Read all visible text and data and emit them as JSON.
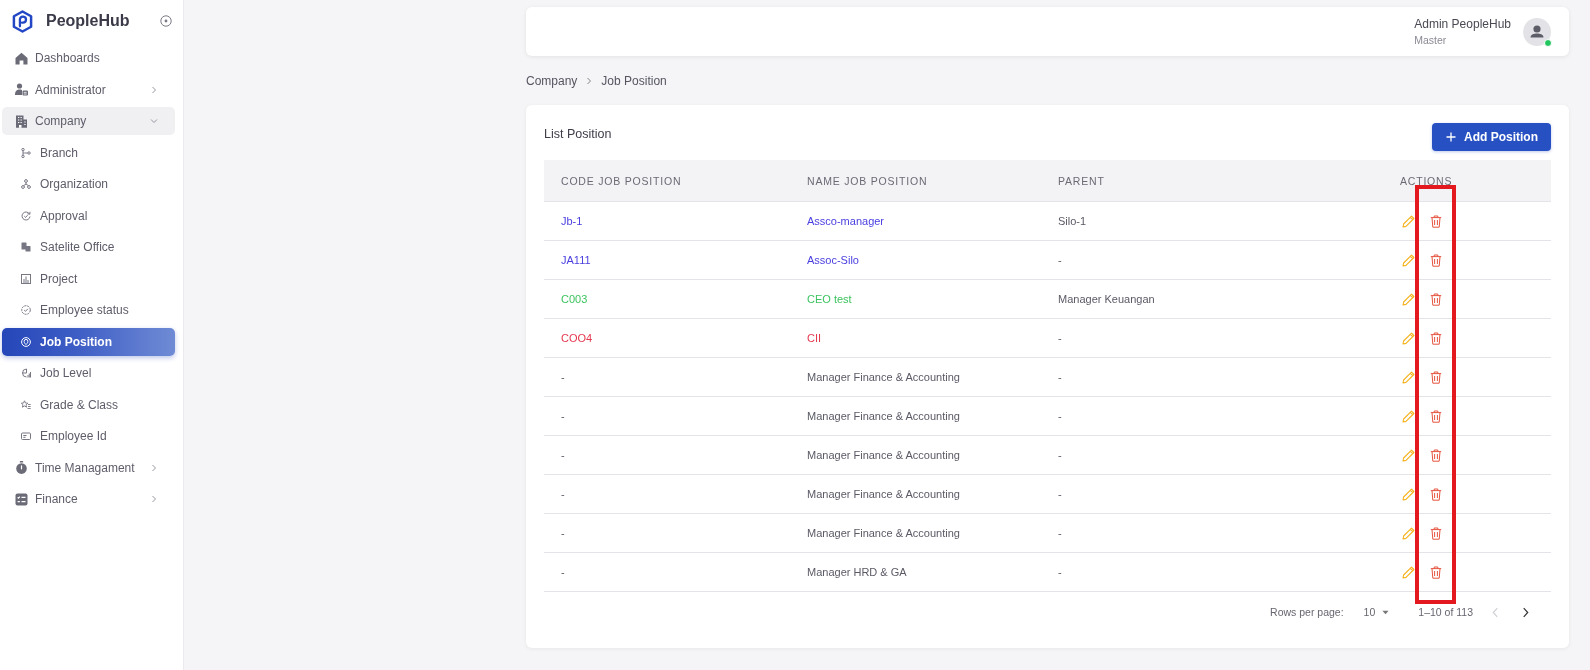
{
  "sidebar": {
    "app_name": "PeopleHub",
    "items": [
      {
        "label": "Dashboards",
        "kind": "link",
        "selected": false
      },
      {
        "label": "Administrator",
        "kind": "group",
        "selected": false,
        "expanded": false
      },
      {
        "label": "Company",
        "kind": "group",
        "selected": false,
        "expanded": true,
        "children": [
          {
            "label": "Branch",
            "selected": false
          },
          {
            "label": "Organization",
            "selected": false
          },
          {
            "label": "Approval",
            "selected": false
          },
          {
            "label": "Satelite Office",
            "selected": false
          },
          {
            "label": "Project",
            "selected": false
          },
          {
            "label": "Employee status",
            "selected": false
          },
          {
            "label": "Job Position",
            "selected": true
          },
          {
            "label": "Job Level",
            "selected": false
          },
          {
            "label": "Grade & Class",
            "selected": false
          },
          {
            "label": "Employee Id",
            "selected": false
          }
        ]
      },
      {
        "label": "Time Managament",
        "kind": "group",
        "selected": false,
        "expanded": false
      },
      {
        "label": "Finance",
        "kind": "group",
        "selected": false,
        "expanded": false
      }
    ]
  },
  "header": {
    "user": {
      "name": "Admin PeopleHub",
      "role": "Master",
      "online": true
    }
  },
  "breadcrumb": [
    "Company",
    "Job Position"
  ],
  "card": {
    "title": "List Position",
    "add_button": "Add Position",
    "table": {
      "columns": [
        "CODE JOB POSITION",
        "NAME JOB POSITION",
        "PARENT",
        "ACTIONS"
      ],
      "rows": [
        {
          "code": "Jb-1",
          "name": "Assco-manager",
          "parent": "Silo-1",
          "color": "#4a3fe0"
        },
        {
          "code": "JA111",
          "name": "Assoc-Silo",
          "parent": "-",
          "color": "#4a3fe0"
        },
        {
          "code": "C003",
          "name": "CEO test",
          "parent": "Manager Keuangan",
          "color": "#3cc35f"
        },
        {
          "code": "COO4",
          "name": "CII",
          "parent": "-",
          "color": "#e5384f"
        },
        {
          "code": "-",
          "name": "Manager Finance & Accounting",
          "parent": "-"
        },
        {
          "code": "-",
          "name": "Manager Finance & Accounting",
          "parent": "-"
        },
        {
          "code": "-",
          "name": "Manager Finance & Accounting",
          "parent": "-"
        },
        {
          "code": "-",
          "name": "Manager Finance & Accounting",
          "parent": "-"
        },
        {
          "code": "-",
          "name": "Manager Finance & Accounting",
          "parent": "-"
        },
        {
          "code": "-",
          "name": "Manager HRD & GA",
          "parent": "-"
        }
      ]
    },
    "pagination": {
      "rows_per_page_label": "Rows per page:",
      "rows_per_page": "10",
      "range": "1–10 of 113",
      "prev_disabled": true,
      "next_disabled": false
    }
  },
  "highlight_box": true
}
